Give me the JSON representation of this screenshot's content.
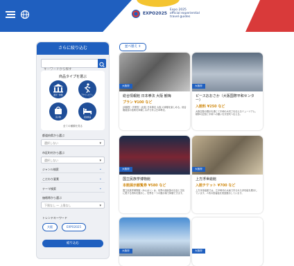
{
  "header": {
    "logo_word": "EXPO2025",
    "logo_sub1": "Expo 2025",
    "logo_sub2": "official experiential",
    "logo_sub3": "travel guides"
  },
  "sidebar": {
    "title": "さらに絞り込む",
    "search_placeholder": "キーワードから探す",
    "type_title": "商品タイプを選ぶ",
    "types": [
      "観光・体験",
      "アクティビティ",
      "買い物",
      "宿泊施設"
    ],
    "more": "全ての種類を見る",
    "area_label": "都道府県から選ぶ",
    "area_value": "選択しない",
    "city_label": "市区町村から選ぶ",
    "city_value": "選択しない",
    "accordions": [
      "ジャンル検索",
      "こだわり要素",
      "テーマ検索"
    ],
    "price_label": "価格帯から選ぶ",
    "price_value": "下限なし 〜 上限なし",
    "trending_label": "トレンドキーワード",
    "tags": [
      "大阪",
      "EXPO2025"
    ],
    "apply": "絞り込む"
  },
  "sort": {
    "label": "並べ替え"
  },
  "cards": [
    {
      "area": "大阪府",
      "title": "総合情報館 日本拳法 大阪 観梅",
      "price": "プラン ¥100 など",
      "desc": "[体験型・作業型・武道] 日本拳法 大阪 の体験を楽しめる。総合格闘技の技術を体験しながら学ぶ日本拳法。"
    },
    {
      "area": "大阪府",
      "title": "ピースおおさか（大阪国際平和センター）",
      "price": "入館料 ¥250 など",
      "desc": "大阪空襲の展示を通じて平和の大切さを伝えるミュージアム。戦争の記憶と平和への願いを次世代へ伝える。"
    },
    {
      "area": "大阪府",
      "title": "国立民族学博物館",
      "price": "本館展示観覧券 ¥580 など",
      "desc": "国立民族学博物館（みんぱく）は、世界の諸民族の社会と文化に関する資料を展示し、世界を一つの展示場で体験できます。"
    },
    {
      "area": "大阪府",
      "title": "上方浮世絵館",
      "price": "入館チケット ¥700 など",
      "desc": "上方浮世絵館では、江戸時代の大坂で作られた浮世絵を展示しています。人気の役者絵を常設展示しています。"
    },
    {
      "area": "大阪府",
      "title": "",
      "price": "",
      "desc": ""
    },
    {
      "area": "大阪府",
      "title": "",
      "price": "",
      "desc": ""
    }
  ],
  "colors": {
    "brand_blue": "#1f5fbf",
    "accent_red": "#d93a3a",
    "price_orange": "#d08a12"
  }
}
